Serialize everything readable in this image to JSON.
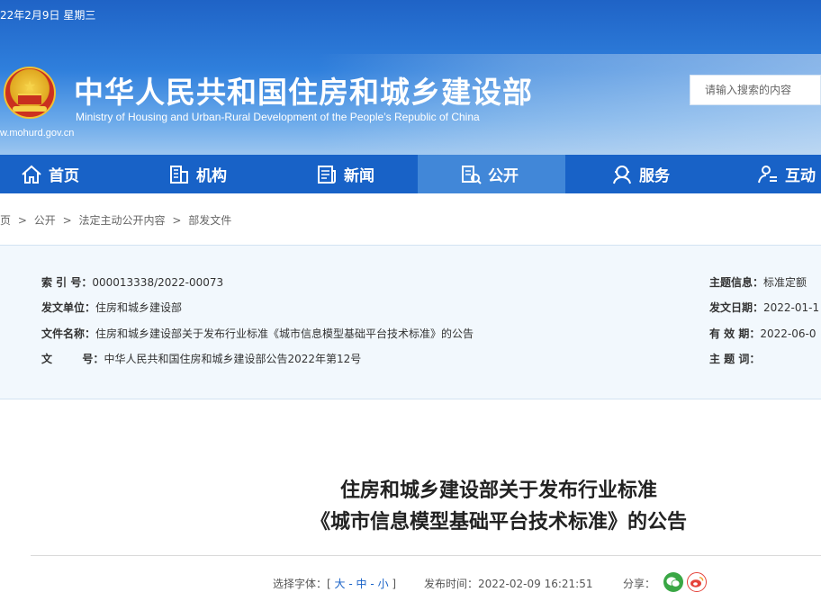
{
  "header": {
    "date": "22年2月9日  星期三",
    "title_cn": "中华人民共和国住房和城乡建设部",
    "title_en": "Ministry of Housing and Urban-Rural Development of the People’s Republic of China",
    "site_url": "w.mohurd.gov.cn",
    "search_placeholder": "请输入搜索的内容"
  },
  "nav": {
    "items": [
      {
        "label": "首页",
        "icon": "home-icon"
      },
      {
        "label": "机构",
        "icon": "building-icon"
      },
      {
        "label": "新闻",
        "icon": "news-icon"
      },
      {
        "label": "公开",
        "icon": "disclosure-icon",
        "active": true
      },
      {
        "label": "服务",
        "icon": "service-icon"
      },
      {
        "label": "互动",
        "icon": "interaction-icon"
      }
    ]
  },
  "breadcrumb": {
    "start": "页",
    "items": [
      "公开",
      "法定主动公开内容",
      "部发文件"
    ],
    "separator": ">"
  },
  "info": {
    "index_label": "索 引 号：",
    "index_value": "000013338/2022-00073",
    "issuer_label": "发文单位：",
    "issuer_value": "住房和城乡建设部",
    "filename_label": "文件名称：",
    "filename_value": "住房和城乡建设部关于发布行业标准《城市信息模型基础平台技术标准》的公告",
    "docno_label": "文        号：",
    "docno_value": "中华人民共和国住房和城乡建设部公告2022年第12号",
    "topic_label": "主题信息：",
    "topic_value": "标准定额",
    "issue_date_label": "发文日期：",
    "issue_date_value": "2022-01-1",
    "valid_label": "有 效 期：",
    "valid_value": "2022-06-0",
    "keywords_label": "主 题 词："
  },
  "article": {
    "title_line1": "住房和城乡建设部关于发布行业标准",
    "title_line2": "《城市信息模型基础平台技术标准》的公告"
  },
  "meta": {
    "font_label": "选择字体：",
    "bracket_open": "[",
    "size_large": "大",
    "size_medium": "中",
    "size_small": "小",
    "sep": "-",
    "bracket_close": "]",
    "publish_label": "发布时间：",
    "publish_value": "2022-02-09 16:21:51",
    "share_label": "分享："
  },
  "colors": {
    "nav_bg": "#1862c7",
    "nav_active": "#4187d8",
    "info_bg": "#f2f8fd",
    "wechat": "#3aa745",
    "weibo": "#e5423a"
  }
}
